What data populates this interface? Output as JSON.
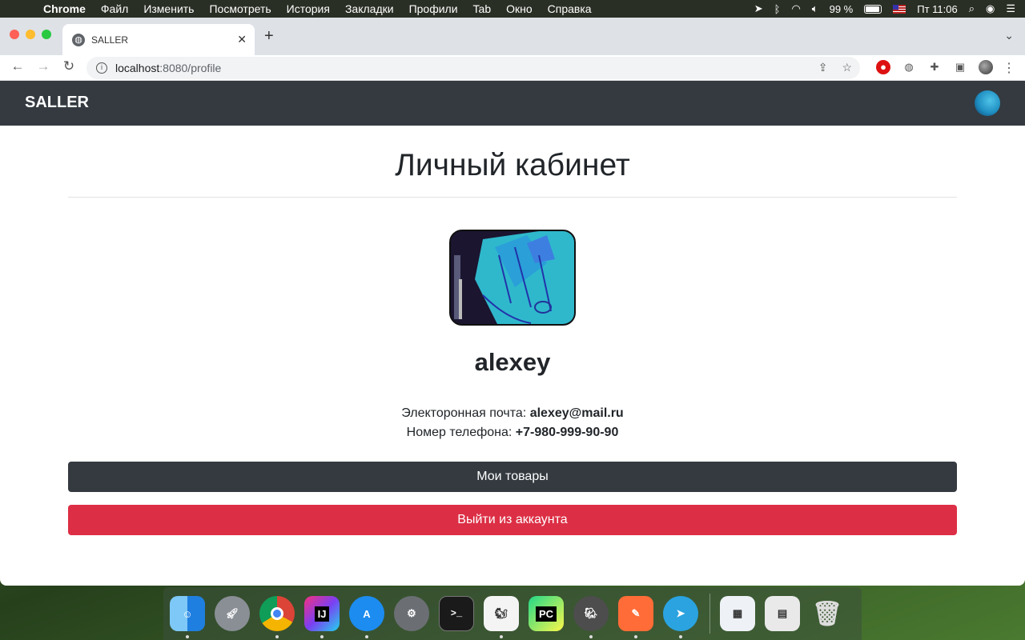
{
  "menubar": {
    "app": "Chrome",
    "items": [
      "Файл",
      "Изменить",
      "Посмотреть",
      "История",
      "Закладки",
      "Профили",
      "Tab",
      "Окно",
      "Справка"
    ],
    "battery": "99 %",
    "time": "Пт 11:06"
  },
  "browser": {
    "tab_title": "SALLER",
    "url_host": "localhost",
    "url_path": ":8080/profile"
  },
  "navbar": {
    "brand": "SALLER"
  },
  "profile": {
    "title": "Личный кабинет",
    "username": "alexey",
    "email_label": "Электоронная почта:",
    "email": "alexey@mail.ru",
    "phone_label": "Номер телефона:",
    "phone": "+7-980-999-90-90",
    "my_products_button": "Мои товары",
    "logout_button": "Выйти из аккаунта"
  },
  "colors": {
    "navbar": "#343a40",
    "danger": "#dc2f45"
  },
  "dock": {
    "items": [
      "finder-icon",
      "launchpad-icon",
      "chrome-icon",
      "intellij-icon",
      "app-store-icon",
      "system-preferences-icon",
      "terminal-icon",
      "pycharm-ce-icon",
      "pycharm-icon",
      "postgres-icon",
      "postman-icon",
      "telegram-icon",
      "downloads-icon",
      "documents-icon",
      "trash-icon"
    ]
  }
}
